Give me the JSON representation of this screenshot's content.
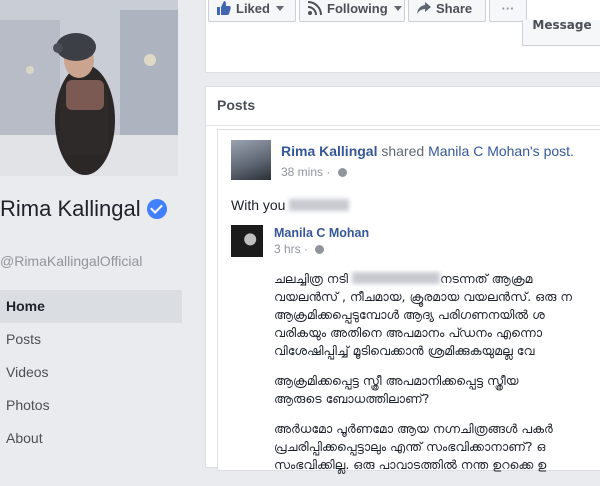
{
  "profile": {
    "name": "Rima Kallingal",
    "handle": "@RimaKallingalOfficial",
    "verified": true,
    "accent": "#4080ff"
  },
  "nav": {
    "items": [
      {
        "label": "Home",
        "active": true
      },
      {
        "label": "Posts",
        "active": false
      },
      {
        "label": "Videos",
        "active": false
      },
      {
        "label": "Photos",
        "active": false
      },
      {
        "label": "About",
        "active": false
      }
    ]
  },
  "actions": {
    "liked": "Liked",
    "following": "Following",
    "share": "Share",
    "more": "···",
    "message": "Message"
  },
  "posts": {
    "heading": "Posts",
    "post": {
      "author": "Rima Kallingal",
      "verb": "shared",
      "source": "Manila C Mohan's post.",
      "time": "38 mins",
      "body_prefix": "With you",
      "shared": {
        "author": "Manila C Mohan",
        "time": "3 hrs",
        "paragraphs": [
          [
            "ചലച്ചിത്ര നടി",
            "നടന്നത് ആക്രമ",
            "വയലൻസ് , നീചമായ, ക്രൂരമായ വയലൻസ്. ഒരു ന",
            "ആക്രമിക്കപ്പെടുമ്പോൾ ആദ്യ പരിഗണനയിൽ ശ",
            "വരികയും അതിനെ അപമാനം പ്ഡനം എന്നൊ",
            "വിശേഷിപ്പിച്ച് മൂടിവെക്കാൻ ശ്രമിക്കുകയുമല്ല വേ"
          ],
          [
            "ആക്രമിക്കപ്പെട്ട സ്ത്രീ അപമാനിക്കപ്പെട്ട സ്ത്രീയ",
            "ആരുടെ ബോധത്തിലാണ്?"
          ],
          [
            "അർധമോ പൂർണമോ ആയ നഗ്നചിത്രങ്ങൾ പകർ",
            "പ്രചരിപ്പിക്കപ്പെട്ടാലും എന്ത് സംഭവിക്കാനാണ്? ഒ",
            "സംഭവിക്കില്ല. ഒരു പാവാടത്തിൽ നന്ത ഉറക്കെ ഉ"
          ]
        ]
      }
    }
  }
}
